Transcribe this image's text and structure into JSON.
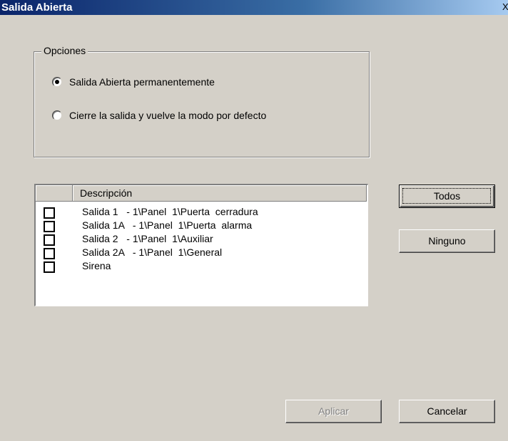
{
  "window": {
    "title": "Salida Abierta",
    "close_glyph": "X"
  },
  "options": {
    "legend": "Opciones",
    "choices": [
      {
        "label": "Salida Abierta permanentemente",
        "selected": true
      },
      {
        "label": "Cierre la salida y vuelve la modo por defecto",
        "selected": false
      }
    ]
  },
  "list": {
    "column_header": "Descripción",
    "items": [
      {
        "text": "Salida 1   - 1\\Panel  1\\Puerta  cerradura",
        "checked": false
      },
      {
        "text": "Salida 1A   - 1\\Panel  1\\Puerta  alarma",
        "checked": false
      },
      {
        "text": "Salida 2   - 1\\Panel  1\\Auxiliar",
        "checked": false
      },
      {
        "text": "Salida 2A   - 1\\Panel  1\\General",
        "checked": false
      },
      {
        "text": "Sirena",
        "checked": false
      }
    ]
  },
  "buttons": {
    "all": "Todos",
    "none": "Ninguno",
    "apply": "Aplicar",
    "cancel": "Cancelar"
  }
}
